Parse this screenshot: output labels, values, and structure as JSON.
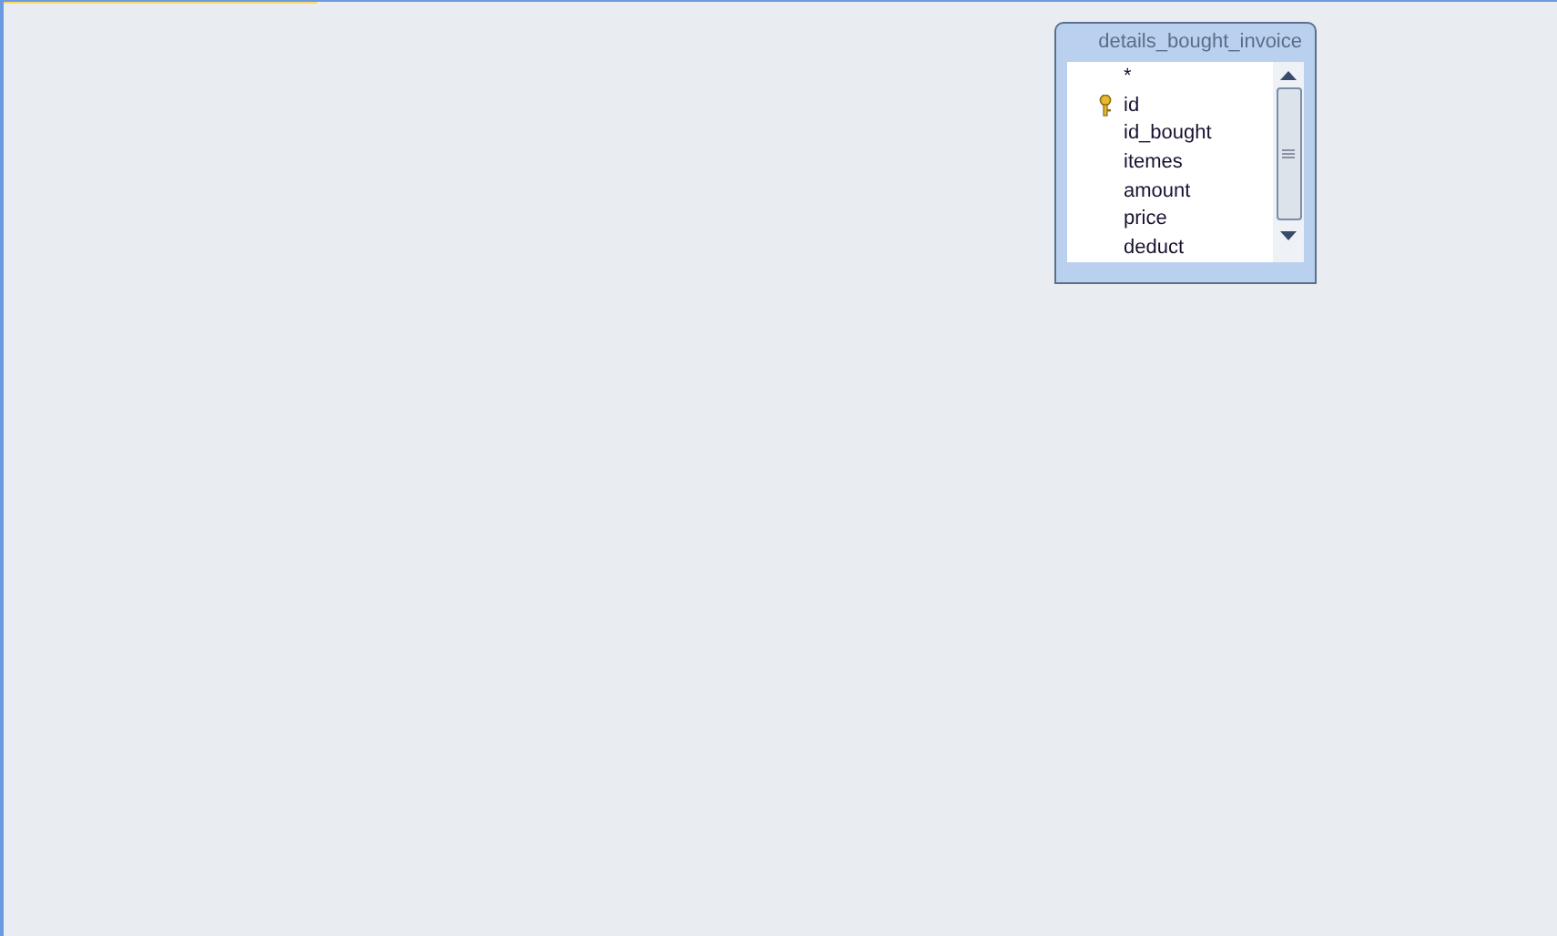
{
  "table": {
    "title": "details_bought_invoice",
    "fields": [
      {
        "name": "*",
        "primary_key": false
      },
      {
        "name": "id",
        "primary_key": true
      },
      {
        "name": "id_bought",
        "primary_key": false
      },
      {
        "name": "itemes",
        "primary_key": false
      },
      {
        "name": "amount",
        "primary_key": false
      },
      {
        "name": "price",
        "primary_key": false
      },
      {
        "name": "deduct",
        "primary_key": false
      }
    ]
  }
}
